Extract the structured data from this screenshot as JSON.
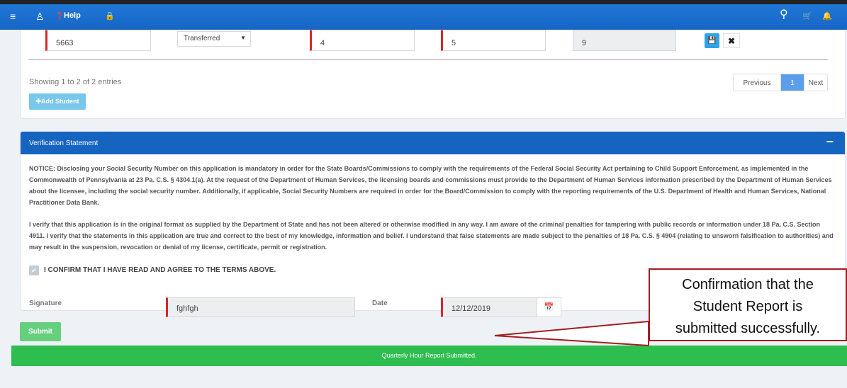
{
  "topbar": {
    "menu_icon": "≡",
    "user_icon": "♙",
    "help_label": "Help",
    "help_icon": "❓",
    "lock_icon": "🔒",
    "search_icon": "⚲",
    "cart_icon": "🛒",
    "bell_icon": "🔔"
  },
  "student_row": {
    "id_value": "5663",
    "status_select": "Transferred",
    "field_a": "4",
    "field_b": "5",
    "total": "9"
  },
  "table_footer": {
    "showing": "Showing 1 to 2 of 2 entries",
    "prev_label": "Previous",
    "page_label": "1",
    "next_label": "Next",
    "add_student_label": "✚Add Student"
  },
  "verification": {
    "title": "Verification Statement",
    "collapse": "−",
    "notice": "NOTICE: Disclosing your Social Security Number on this application is mandatory in order for the State Boards/Commissions to comply with the requirements of the Federal Social Security Act pertaining to Child Support Enforcement, as implemented in the Commonwealth of Pennsylvania at 23 Pa. C.S. § 4304.1(a). At the request of the Department of Human Services, the licensing boards and commissions must provide to the Department of Human Services information prescribed by the Department of Human Services about the licensee, including the social security number. Additionally, if applicable, Social Security Numbers are required in order for the Board/Commission to comply with the reporting requirements of the U.S. Department of Health and Human Services, National Practitioner Data Bank.",
    "verify": "I verify that this application is in the original format as supplied by the Department of State and has not been altered or otherwise modified in any way. I am aware of the criminal penalties for tampering with public records or information under 18 Pa. C.S. Section 4911. I verify that the statements in this application are true and correct to the best of my knowledge, information and belief. I understand that false statements are made subject to the penalties of 18 Pa. C.S. § 4904 (relating to unsworn falsification to authorities) and may result in the suspension, revocation or denial of my license, certificate, permit or registration.",
    "confirm_label": "I CONFIRM THAT I HAVE READ AND AGREE TO THE TERMS ABOVE.",
    "signature_label": "Signature",
    "signature_value": "fghfgh",
    "date_label": "Date",
    "date_value": "12/12/2019",
    "calendar_icon": "📅"
  },
  "submit_label": "Submit",
  "success_message": "Quarterly Hour Report Submitted.",
  "annotation": {
    "line1": "Confirmation that the",
    "line2": "Student Report is",
    "line3": "submitted successfully."
  },
  "colors": {
    "topbar": "#1f78d6",
    "panel_header": "#1564c0",
    "success": "#2ebd4f",
    "callout_border": "#a31e22"
  }
}
